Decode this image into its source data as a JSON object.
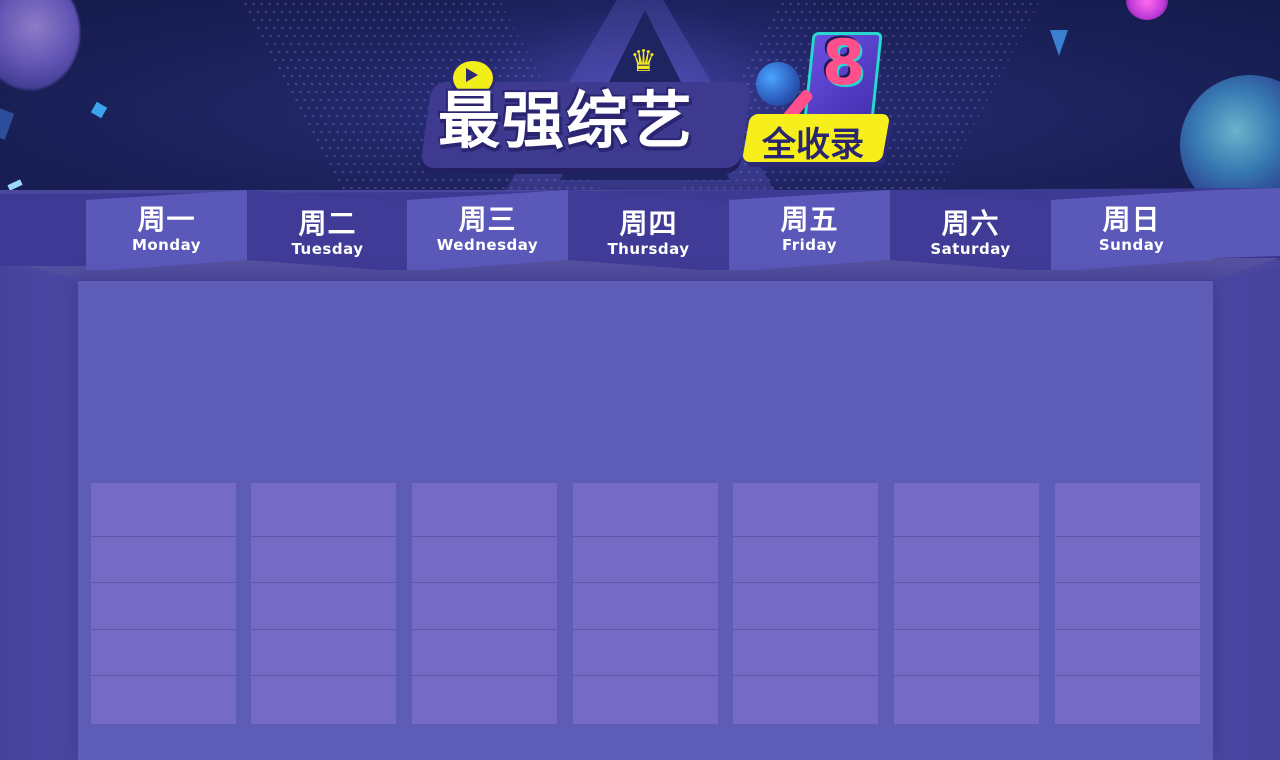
{
  "banner": {
    "logo_title": "最强综艺",
    "logo_badge": "全收录",
    "logo_number": "8",
    "icons": [
      "play-icon",
      "crown-icon",
      "microphone-icon",
      "speaker-icon"
    ]
  },
  "days": [
    {
      "cn": "周一",
      "en": "Monday",
      "style": "light"
    },
    {
      "cn": "周二",
      "en": "Tuesday",
      "style": "dark"
    },
    {
      "cn": "周三",
      "en": "Wednesday",
      "style": "light"
    },
    {
      "cn": "周四",
      "en": "Thursday",
      "style": "dark"
    },
    {
      "cn": "周五",
      "en": "Friday",
      "style": "light"
    },
    {
      "cn": "周六",
      "en": "Saturday",
      "style": "dark"
    },
    {
      "cn": "周日",
      "en": "Sunday",
      "style": "light"
    }
  ],
  "schedule": {
    "slots_per_day": 5
  },
  "colors": {
    "background": "#4a479d",
    "panel": "#5d5db7",
    "slot": "#756bc4",
    "tab_light": "#5a58b9",
    "tab_dark": "#3f3b96",
    "accent_yellow": "#f6ef1b"
  }
}
